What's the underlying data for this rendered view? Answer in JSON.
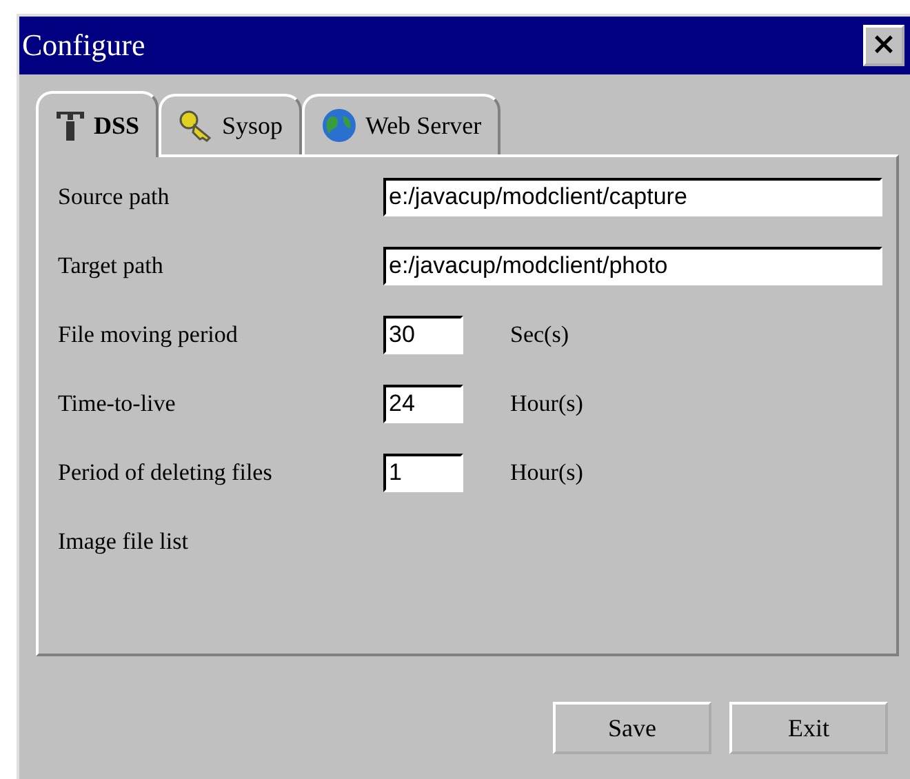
{
  "window": {
    "title": "Configure",
    "close": "×"
  },
  "tabs": [
    {
      "label": "DSS",
      "kind": "tools",
      "selected": true
    },
    {
      "label": "Sysop",
      "kind": "key",
      "selected": false
    },
    {
      "label": "Web Server",
      "kind": "globe",
      "selected": false
    }
  ],
  "fields": [
    {
      "label": "Source path",
      "value": "e:/javacup/modclient/capture",
      "kind": "wide"
    },
    {
      "label": "Target path",
      "value": "e:/javacup/modclient/photo",
      "kind": "wide"
    },
    {
      "label": "File moving period",
      "value": "30",
      "unit": "Sec(s)",
      "kind": "short"
    },
    {
      "label": "Time-to-live",
      "value": "24",
      "unit": "Hour(s)",
      "kind": "short"
    },
    {
      "label": "Period of deleting files",
      "value": "1",
      "unit": "Hour(s)",
      "kind": "short"
    }
  ],
  "list_label": "Image file list",
  "buttons": [
    "Save",
    "Exit"
  ]
}
